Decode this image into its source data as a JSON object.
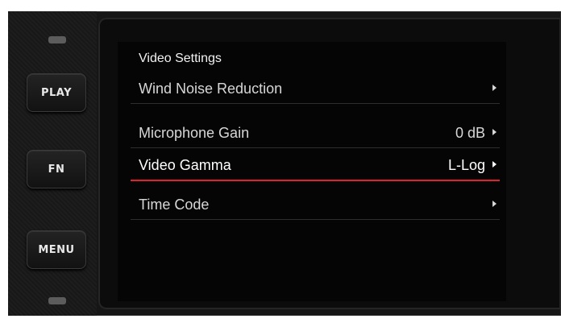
{
  "buttons": {
    "play_label": "PLAY",
    "fn_label": "FN",
    "menu_label": "MENU"
  },
  "menu": {
    "title": "Video Settings",
    "items": [
      {
        "label": "Wind Noise Reduction",
        "value": ""
      },
      {
        "label": "Microphone Gain",
        "value": "0 dB"
      },
      {
        "label": "Video Gamma",
        "value": "L-Log"
      },
      {
        "label": "Time Code",
        "value": ""
      }
    ],
    "selected_index": 2
  },
  "colors": {
    "selection_underline": "#e0222c",
    "screen_background": "#050505",
    "text": "#d7d7d7"
  },
  "icons": [
    "right-arrow-icon"
  ]
}
